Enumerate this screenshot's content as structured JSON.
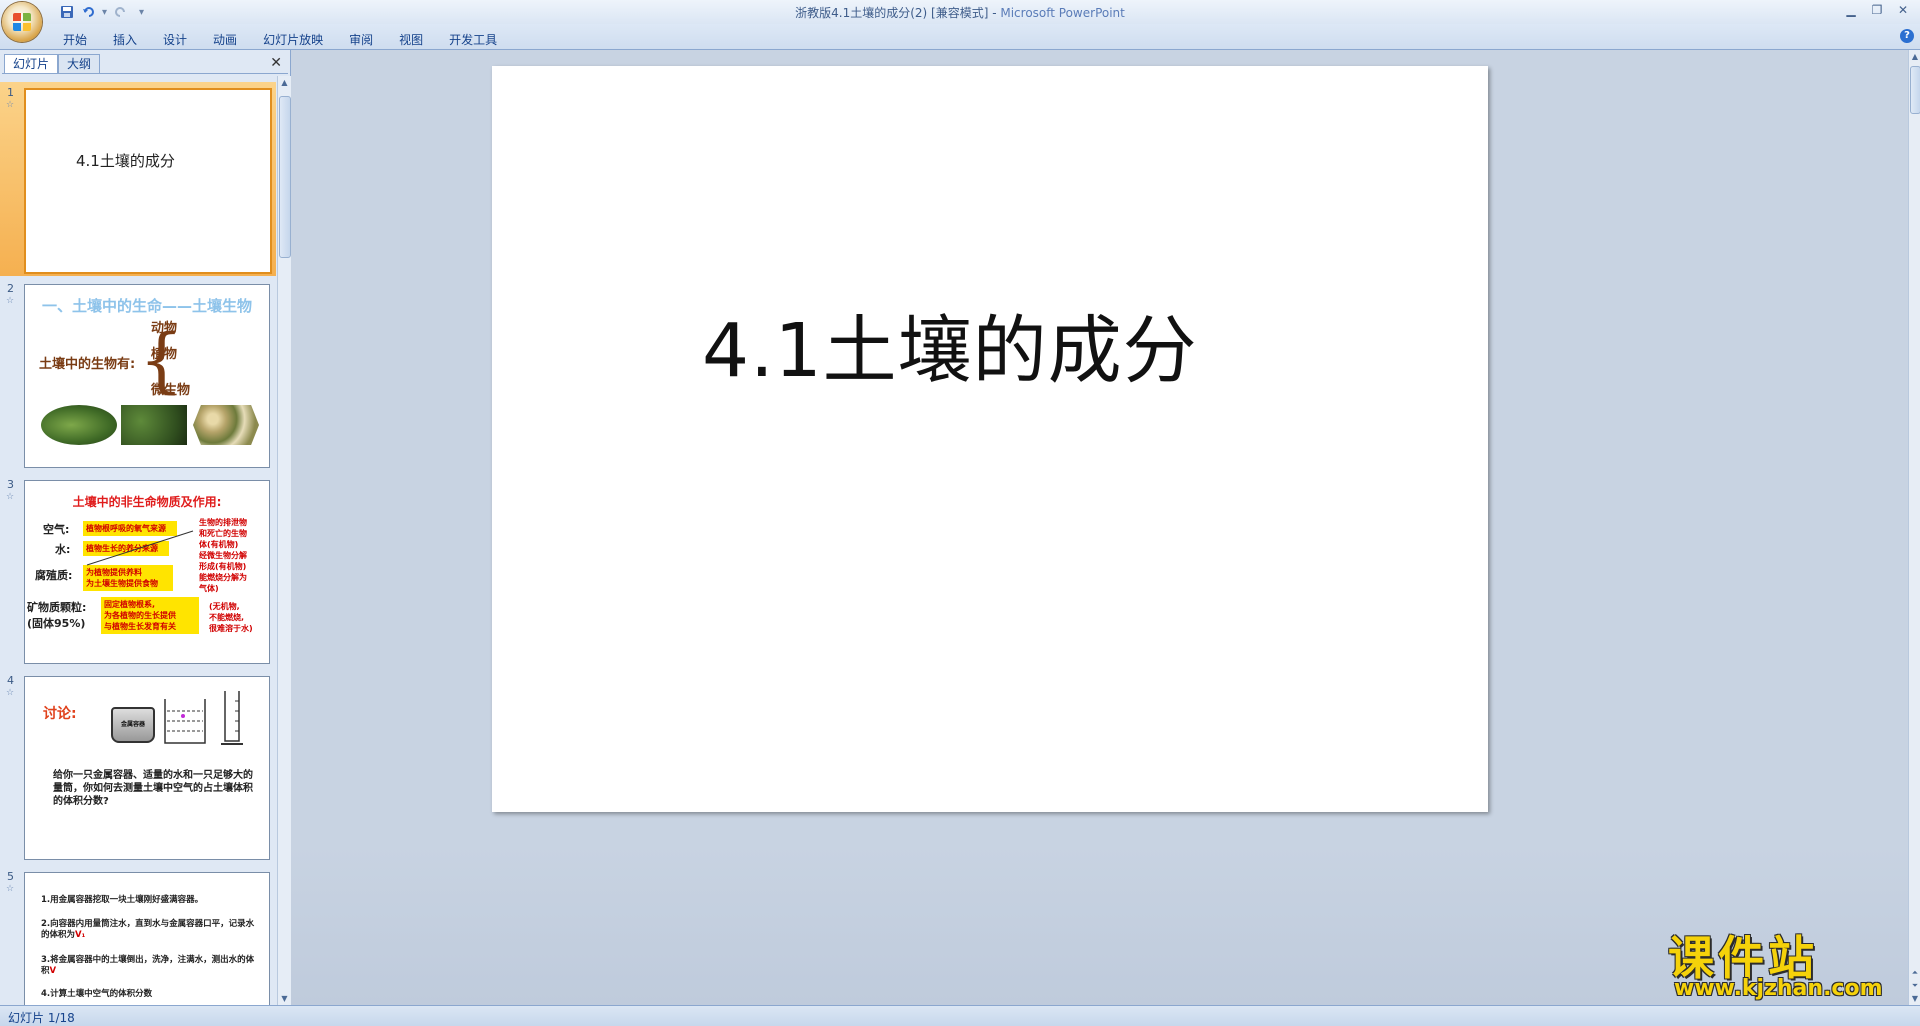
{
  "window": {
    "title": "浙教版4.1土壤的成分(2) [兼容模式] - ",
    "app_name": "Microsoft PowerPoint"
  },
  "quick_access": [
    "save-icon",
    "undo-icon",
    "redo-icon",
    "customize-icon"
  ],
  "ribbon": {
    "tabs": [
      "开始",
      "插入",
      "设计",
      "动画",
      "幻灯片放映",
      "审阅",
      "视图",
      "开发工具"
    ]
  },
  "left_pane": {
    "tabs": [
      "幻灯片",
      "大纲"
    ],
    "thumbnails": [
      {
        "number": "1",
        "title": "4.1土壤的成分"
      },
      {
        "number": "2",
        "title": "一、土壤中的生命——土壤生物",
        "label": "土壤中的生物有:",
        "items": [
          "动物",
          "植物",
          "微生物"
        ]
      },
      {
        "number": "3",
        "title": "土壤中的非生命物质及作用:",
        "labels": [
          "空气:",
          "水:",
          "腐殖质:",
          "矿物质颗粒:",
          "(固体95%)"
        ],
        "boxes": [
          "植物根呼吸的氧气来源",
          "植物生长的养分来源",
          "为植物提供养料",
          "为土壤生物提供食物",
          "固定植物根系,",
          "为各植物的生长提供",
          "与植物生长发育有关"
        ],
        "notes": [
          "生物的排泄物",
          "和死亡的生物",
          "体(有机物)",
          "经微生物分解",
          "形成(有机物)",
          "能燃烧分解为",
          "气体)",
          "(无机物,",
          "不能燃烧,",
          "很难溶于水)"
        ]
      },
      {
        "number": "4",
        "title": "讨论:",
        "container_label": "金属容器",
        "text": "给你一只金属容器、适量的水和一只足够大的量筒，你如何去测量土壤中空气的占土壤体积的体积分数?"
      },
      {
        "number": "5",
        "lines": [
          {
            "text": "1.用金属容器挖取一块土壤刚好盛满容器。",
            "var": ""
          },
          {
            "text": "2.向容器内用量筒注水，直到水与金属容器口平，记录水的体积为",
            "var": "V₁"
          },
          {
            "text": "3.将金属容器中的土壤倒出，洗净，注满水，测出水的体积",
            "var": "V"
          },
          {
            "text": "4.计算土壤中空气的体积分数",
            "var": ""
          }
        ]
      }
    ]
  },
  "slide": {
    "title": "4.1土壤的成分"
  },
  "status": {
    "slide_counter": "幻灯片 1/18"
  },
  "watermark": {
    "main": "课件站",
    "url": "www.kjzhan.com"
  }
}
